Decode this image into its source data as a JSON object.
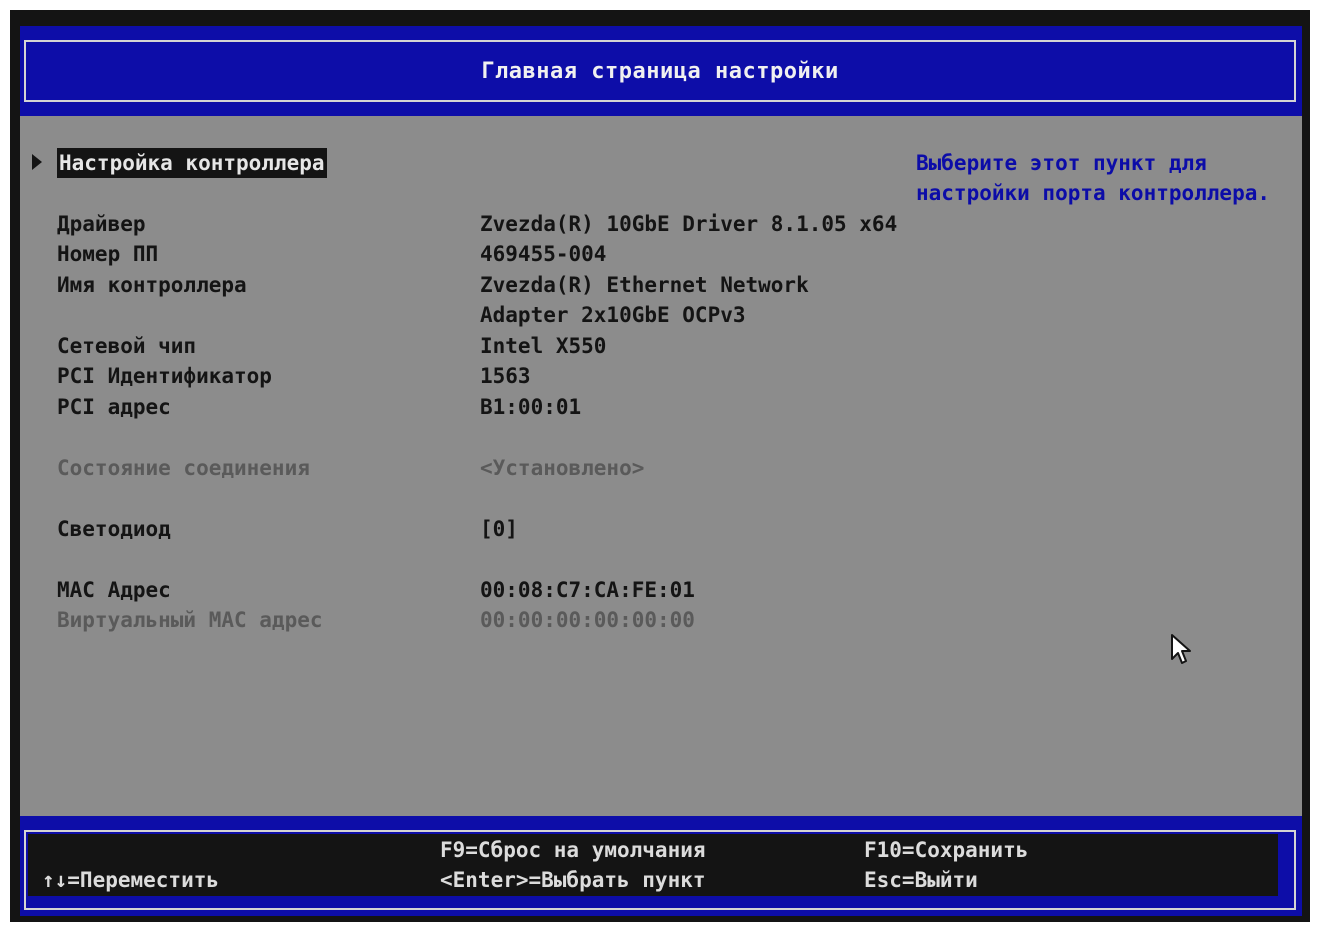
{
  "header": {
    "title": "Главная страница настройки"
  },
  "menu": {
    "selected_label": "Настройка контроллера"
  },
  "help": {
    "line1": "Выберите этот пункт для",
    "line2": "настройки порта контроллера."
  },
  "info": [
    {
      "label": "Драйвер",
      "value": "Zvezda(R) 10GbE Driver 8.1.05 x64"
    },
    {
      "label": "Номер ПП",
      "value": "469455-004"
    },
    {
      "label": "Имя контроллера",
      "value": "Zvezda(R) Ethernet Network",
      "value2": "Adapter 2x10GbE OCPv3"
    },
    {
      "label": "Сетевой чип",
      "value": "Intel X550"
    },
    {
      "label": "PCI Идентификатор",
      "value": "1563"
    },
    {
      "label": "PCI адрес",
      "value": "B1:00:01"
    }
  ],
  "link_state": {
    "label": "Состояние соединения",
    "value": "<Установлено>"
  },
  "led": {
    "label": "Светодиод",
    "value": "[0]"
  },
  "mac": {
    "label": "MAC Адрес",
    "value": "00:08:C7:CA:FE:01"
  },
  "virtual_mac": {
    "label": "Виртуальный MAC адрес",
    "value": "00:00:00:00:00:00"
  },
  "footer": {
    "move": "↑↓=Переместить",
    "defaults": "F9=Сброс на умолчания",
    "select": "<Enter>=Выбрать пункт",
    "save": "F10=Сохранить",
    "exit": "Esc=Выйти"
  },
  "colors": {
    "background": "#8c8c8c",
    "bar": "#0d0da8",
    "help_text": "#0c0ca8",
    "dim_text": "#5a5a5a"
  },
  "icons": {
    "menu_marker": "triangle-right",
    "pointer": "mouse-cursor"
  }
}
